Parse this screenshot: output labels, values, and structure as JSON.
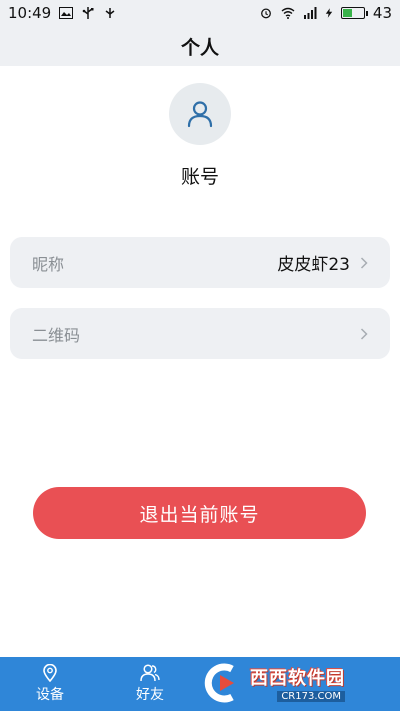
{
  "status_bar": {
    "time": "10:49",
    "battery_level": "43",
    "left_icons": [
      "image-icon",
      "usb-icon",
      "debug-icon"
    ],
    "right_icons": [
      "alarm-icon",
      "wifi-icon",
      "signal-icon",
      "charging-icon",
      "battery-icon"
    ]
  },
  "header": {
    "title": "个人"
  },
  "profile": {
    "avatar_icon": "user-icon",
    "account_label": "账号"
  },
  "settings": {
    "items": [
      {
        "label": "昵称",
        "value": "皮皮虾23",
        "icon": "chevron-right-icon"
      },
      {
        "label": "二维码",
        "icon": "chevron-right-icon"
      }
    ]
  },
  "actions": {
    "logout_label": "退出当前账号",
    "logout_color": "#e95054"
  },
  "tab_bar": {
    "color": "#2f86d8",
    "tabs": [
      {
        "label": "设备",
        "icon": "location-pin-icon"
      },
      {
        "label": "好友",
        "icon": "friends-icon"
      }
    ]
  },
  "watermark": {
    "main": "西西软件园",
    "url": "CR173.COM"
  }
}
